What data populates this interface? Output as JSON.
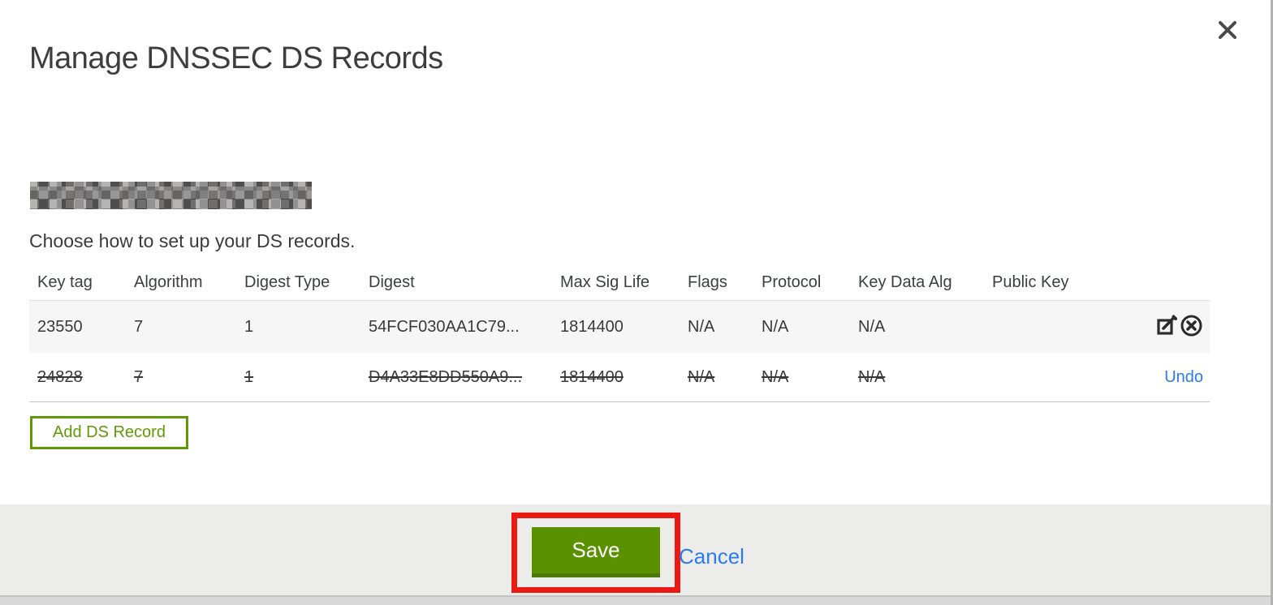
{
  "dialog": {
    "title": "Manage DNSSEC DS Records",
    "instruction": "Choose how to set up your DS records.",
    "domain_redacted": true
  },
  "table": {
    "headers": [
      "Key tag",
      "Algorithm",
      "Digest Type",
      "Digest",
      "Max Sig Life",
      "Flags",
      "Protocol",
      "Key Data Alg",
      "Public Key"
    ],
    "rows": [
      {
        "cells": [
          "23550",
          "7",
          "1",
          "54FCF030AA1C79...",
          "1814400",
          "N/A",
          "N/A",
          "N/A",
          ""
        ],
        "state": "active",
        "actions": [
          "edit",
          "delete"
        ]
      },
      {
        "cells": [
          "24828",
          "7",
          "1",
          "D4A33E8DD550A9...",
          "1814400",
          "N/A",
          "N/A",
          "N/A",
          ""
        ],
        "state": "deleted",
        "action": "Undo"
      }
    ]
  },
  "buttons": {
    "add_ds_record": "Add DS Record",
    "save": "Save",
    "cancel": "Cancel"
  },
  "icons": {
    "close": "close-x",
    "edit": "pencil-in-square",
    "delete": "x-in-circle"
  },
  "colors": {
    "accent_green": "#5f9a06",
    "save_green": "#5a9100",
    "link_blue": "#2d7bf0",
    "annotation_red": "#ea1a13"
  }
}
